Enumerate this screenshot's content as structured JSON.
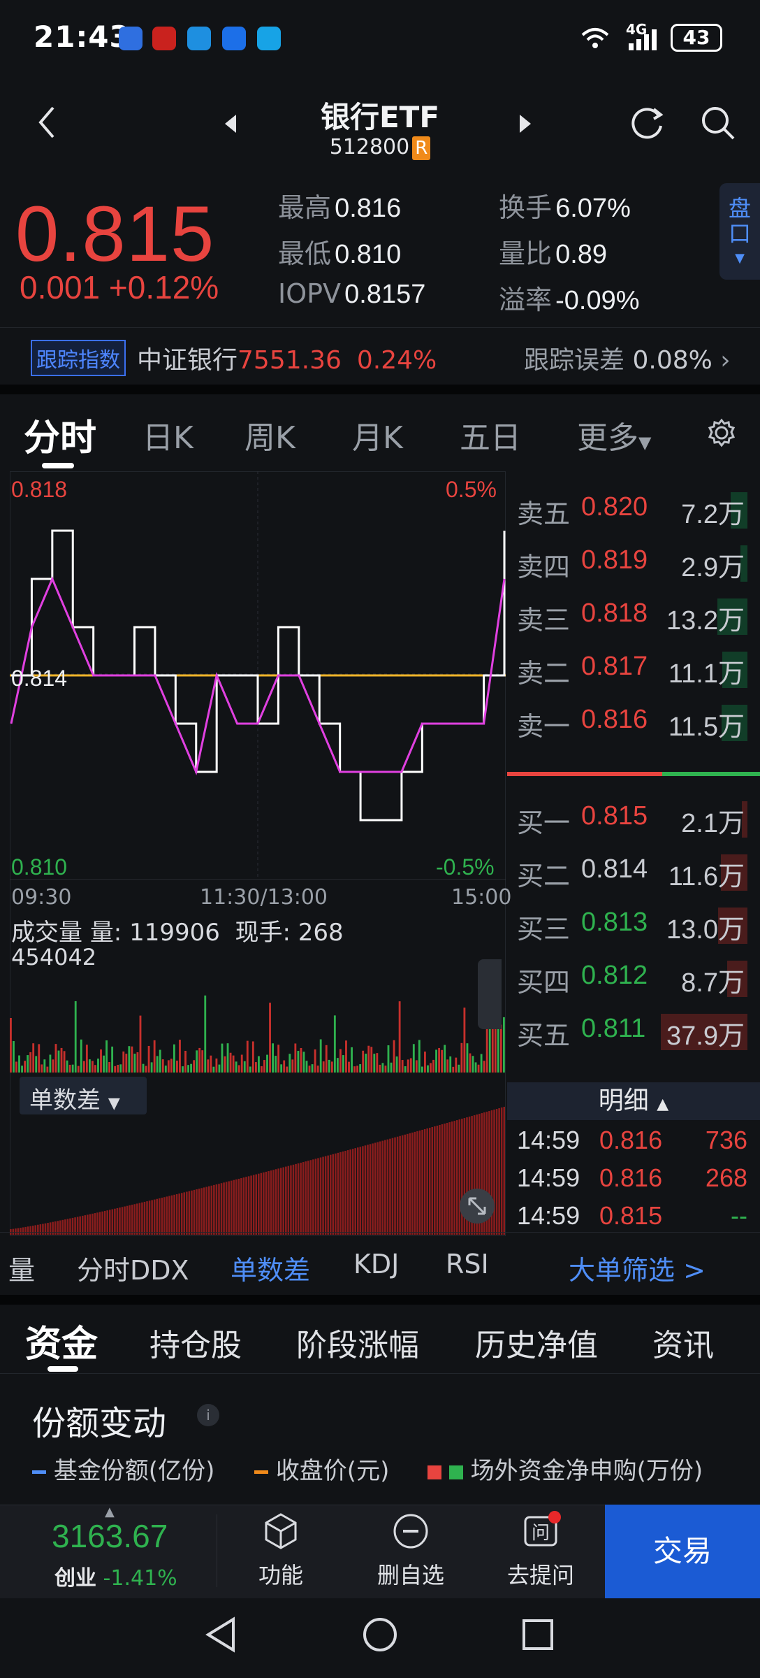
{
  "status": {
    "time": "21:43",
    "battery": "43",
    "network": "4G"
  },
  "header": {
    "title": "银行ETF",
    "code": "512800",
    "badge": "R"
  },
  "quote": {
    "price": "0.815",
    "change": "0.001",
    "change_pct": "+0.12%",
    "high_label": "最高",
    "high": "0.816",
    "low_label": "最低",
    "low": "0.810",
    "iopv_label": "IOPV",
    "iopv": "0.8157",
    "turnover_label": "换手",
    "turnover": "6.07%",
    "vol_ratio_label": "量比",
    "vol_ratio": "0.89",
    "premium_label": "溢率",
    "premium": "-0.09%",
    "pankou": "盘口"
  },
  "tracking": {
    "tag": "跟踪指数",
    "index": "中证银行",
    "value": "7551.36",
    "pct": "0.24%",
    "error_label": "跟踪误差",
    "error": "0.08%"
  },
  "chart_tabs": [
    "分时",
    "日K",
    "周K",
    "月K",
    "五日",
    "更多"
  ],
  "intraday": {
    "high_price": "0.818",
    "high_pct": "0.5%",
    "low_price": "0.810",
    "low_pct": "-0.5%",
    "mid_price": "0.814",
    "time_start": "09:30",
    "time_mid": "11:30/13:00",
    "time_end": "15:00",
    "volume_title": "成交量",
    "volume_label": "量:",
    "volume": "119906",
    "hand_label": "现手:",
    "hand": "268",
    "volume_max": "454042",
    "sub_indicator": "单数差"
  },
  "chart_data": {
    "type": "line",
    "ylim": [
      0.81,
      0.818
    ],
    "series": [],
    "x": [
      0,
      10,
      20,
      30,
      40,
      50,
      60,
      70,
      80,
      90,
      100,
      110,
      120,
      130,
      140,
      150,
      160,
      170,
      180,
      190,
      200,
      210,
      220,
      230,
      240
    ],
    "price": [
      0.814,
      0.816,
      0.817,
      0.815,
      0.814,
      0.814,
      0.815,
      0.814,
      0.813,
      0.812,
      0.814,
      0.814,
      0.813,
      0.815,
      0.814,
      0.813,
      0.812,
      0.811,
      0.811,
      0.812,
      0.813,
      0.813,
      0.813,
      0.814,
      0.817
    ],
    "avg": [
      0.813,
      0.815,
      0.816,
      0.815,
      0.814,
      0.814,
      0.814,
      0.814,
      0.813,
      0.812,
      0.814,
      0.813,
      0.813,
      0.814,
      0.814,
      0.813,
      0.812,
      0.812,
      0.812,
      0.812,
      0.813,
      0.813,
      0.813,
      0.813,
      0.816
    ],
    "ref": 0.814
  },
  "orderbook": {
    "asks": [
      {
        "label": "卖五",
        "price": "0.820",
        "vol": "7.2万",
        "bar": 0.19
      },
      {
        "label": "卖四",
        "price": "0.819",
        "vol": "2.9万",
        "bar": 0.08
      },
      {
        "label": "卖三",
        "price": "0.818",
        "vol": "13.2万",
        "bar": 0.35
      },
      {
        "label": "卖二",
        "price": "0.817",
        "vol": "11.1万",
        "bar": 0.29
      },
      {
        "label": "卖一",
        "price": "0.816",
        "vol": "11.5万",
        "bar": 0.3
      }
    ],
    "bids": [
      {
        "label": "买一",
        "price": "0.815",
        "vol": "2.1万",
        "bar": 0.06
      },
      {
        "label": "买二",
        "price": "0.814",
        "vol": "11.6万",
        "bar": 0.31
      },
      {
        "label": "买三",
        "price": "0.813",
        "vol": "13.0万",
        "bar": 0.34
      },
      {
        "label": "买四",
        "price": "0.812",
        "vol": "8.7万",
        "bar": 0.23
      },
      {
        "label": "买五",
        "price": "0.811",
        "vol": "37.9万",
        "bar": 1.0
      }
    ]
  },
  "detail": {
    "title": "明细",
    "rows": [
      {
        "time": "14:59",
        "price": "0.816",
        "vol": "736"
      },
      {
        "time": "14:59",
        "price": "0.816",
        "vol": "268"
      },
      {
        "time": "14:59",
        "price": "0.815",
        "vol": "--"
      }
    ]
  },
  "indicators": [
    "量",
    "分时DDX",
    "单数差",
    "KDJ",
    "RSI"
  ],
  "filter": "大单筛选 >",
  "lower_tabs": [
    "资金",
    "持仓股",
    "阶段涨幅",
    "历史净值",
    "资讯"
  ],
  "fund": {
    "title": "份额变动",
    "legend": [
      "基金份额(亿份)",
      "收盘价(元)",
      "场外资金净申购(万份)"
    ]
  },
  "bottom": {
    "index_value": "3163.67",
    "index_name": "创业",
    "index_pct": "-1.41%",
    "func": "功能",
    "remove": "删自选",
    "ask": "去提问",
    "trade": "交易"
  }
}
